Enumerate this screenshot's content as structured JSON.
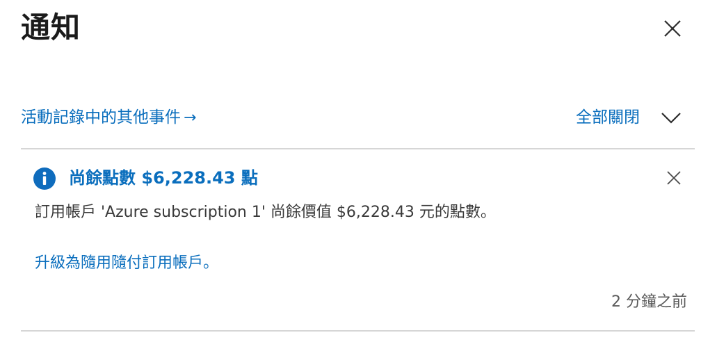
{
  "panel": {
    "title": "通知",
    "close_icon": "close-icon"
  },
  "toolbar": {
    "activity_log_link": "活動記錄中的其他事件",
    "activity_log_arrow": "→",
    "dismiss_all": "全部關閉",
    "collapse_icon": "chevron-down-icon"
  },
  "notifications": [
    {
      "icon": "info-icon",
      "title": "尚餘點數 $6,228.43 點",
      "body": "訂用帳戶 'Azure subscription 1' 尚餘價值 $6,228.43 元的點數。",
      "link": "升級為隨用隨付訂用帳戶。",
      "time": "2 分鐘之前",
      "close_icon": "close-icon"
    }
  ],
  "colors": {
    "accent": "#0a6ebd",
    "info_icon": "#0f6cbd",
    "divider": "#d6d6d6",
    "text": "#3a3a3a"
  }
}
